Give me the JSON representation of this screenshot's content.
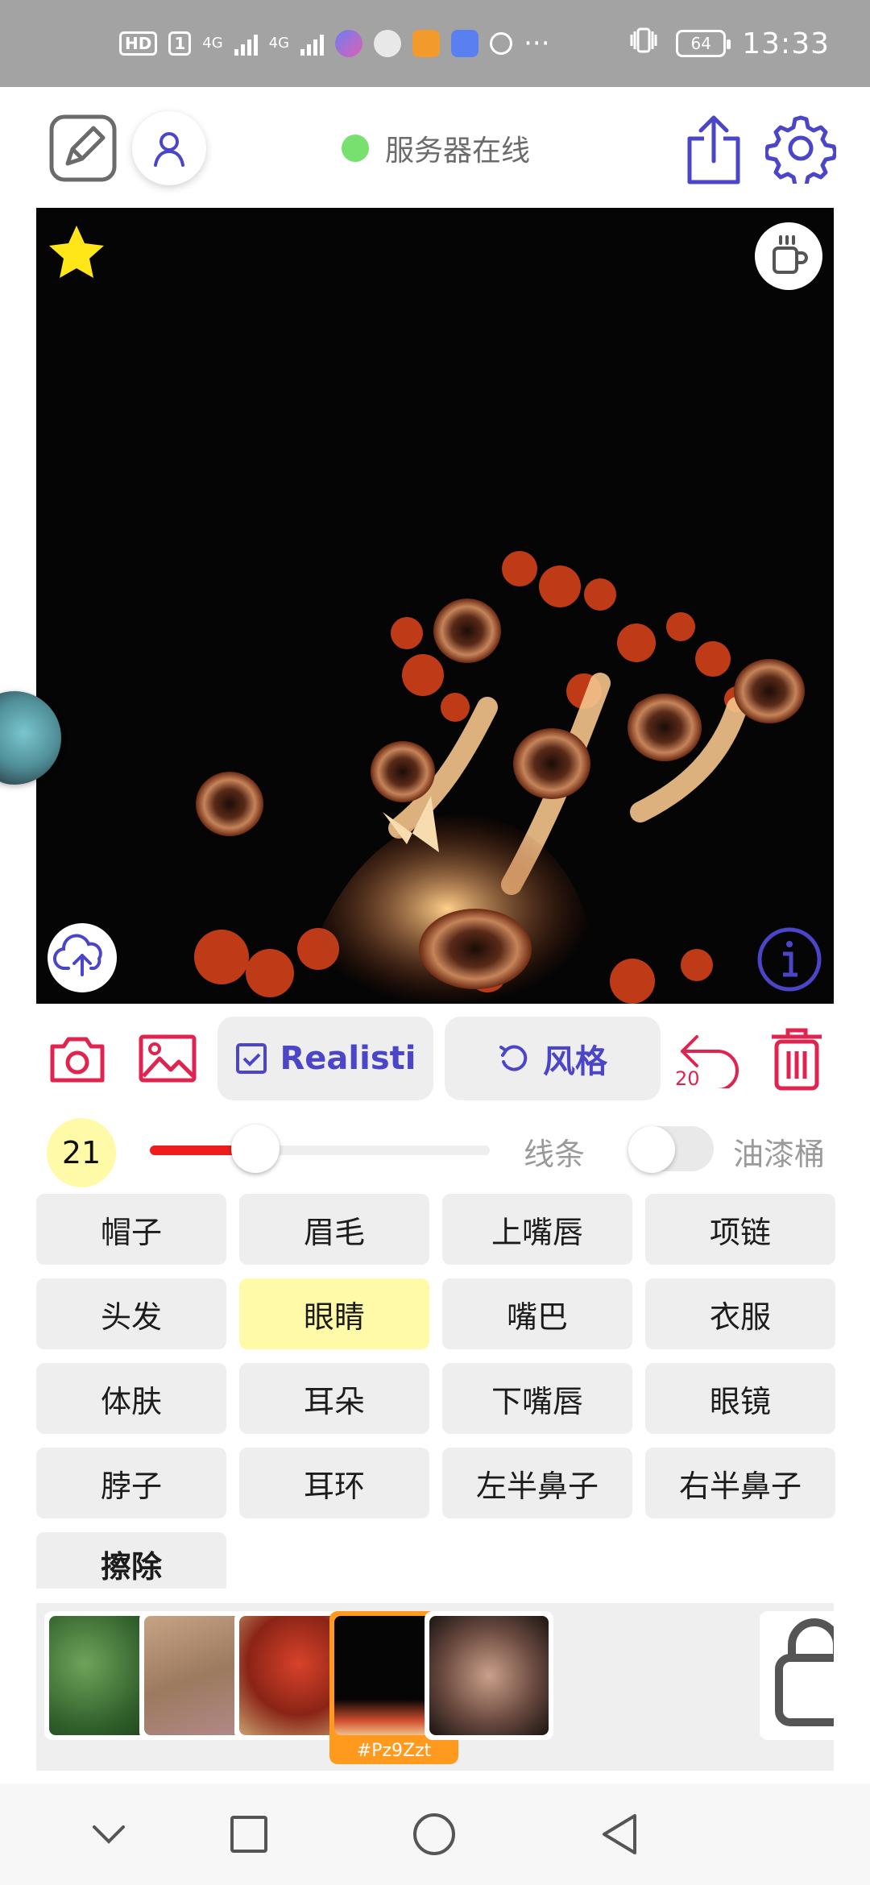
{
  "status_bar": {
    "hd": "HD",
    "sim": "1",
    "net1": "4G",
    "net2": "4G",
    "more": "···",
    "battery": "64",
    "time": "13:33"
  },
  "header": {
    "server_status": "服务器在线",
    "status_color": "#77e06f",
    "icons": [
      "edit-icon",
      "user-icon",
      "share-icon",
      "gear-icon"
    ]
  },
  "canvas": {
    "icons": [
      "star-icon",
      "coffee-cup-icon",
      "upload-cloud-icon",
      "info-icon"
    ]
  },
  "toolbar": {
    "realistic_label": "Realisti",
    "style_label": "风格",
    "undo_count": "20",
    "accent": "#4b45c8",
    "danger": "#e0244f"
  },
  "brush": {
    "size": "21",
    "slider_fraction": 0.31,
    "line_label": "线条",
    "bucket_label": "油漆桶",
    "bucket_on": false
  },
  "parts": [
    {
      "label": "帽子",
      "active": false
    },
    {
      "label": "眉毛",
      "active": false
    },
    {
      "label": "上嘴唇",
      "active": false
    },
    {
      "label": "项链",
      "active": false
    },
    {
      "label": "头发",
      "active": false
    },
    {
      "label": "眼睛",
      "active": true
    },
    {
      "label": "嘴巴",
      "active": false
    },
    {
      "label": "衣服",
      "active": false
    },
    {
      "label": "体肤",
      "active": false
    },
    {
      "label": "耳朵",
      "active": false
    },
    {
      "label": "下嘴唇",
      "active": false
    },
    {
      "label": "眼镜",
      "active": false
    },
    {
      "label": "脖子",
      "active": false
    },
    {
      "label": "耳环",
      "active": false
    },
    {
      "label": "左半鼻子",
      "active": false
    },
    {
      "label": "右半鼻子",
      "active": false
    }
  ],
  "erase_label": "擦除",
  "thumbnails": [
    {
      "selected": false,
      "tag": ""
    },
    {
      "selected": false,
      "tag": ""
    },
    {
      "selected": false,
      "tag": ""
    },
    {
      "selected": true,
      "tag": "#Pz9Zzt"
    },
    {
      "selected": false,
      "tag": ""
    }
  ],
  "navbar": {
    "icons": [
      "chevron-down-icon",
      "square-icon",
      "circle-icon",
      "back-triangle-icon"
    ]
  }
}
